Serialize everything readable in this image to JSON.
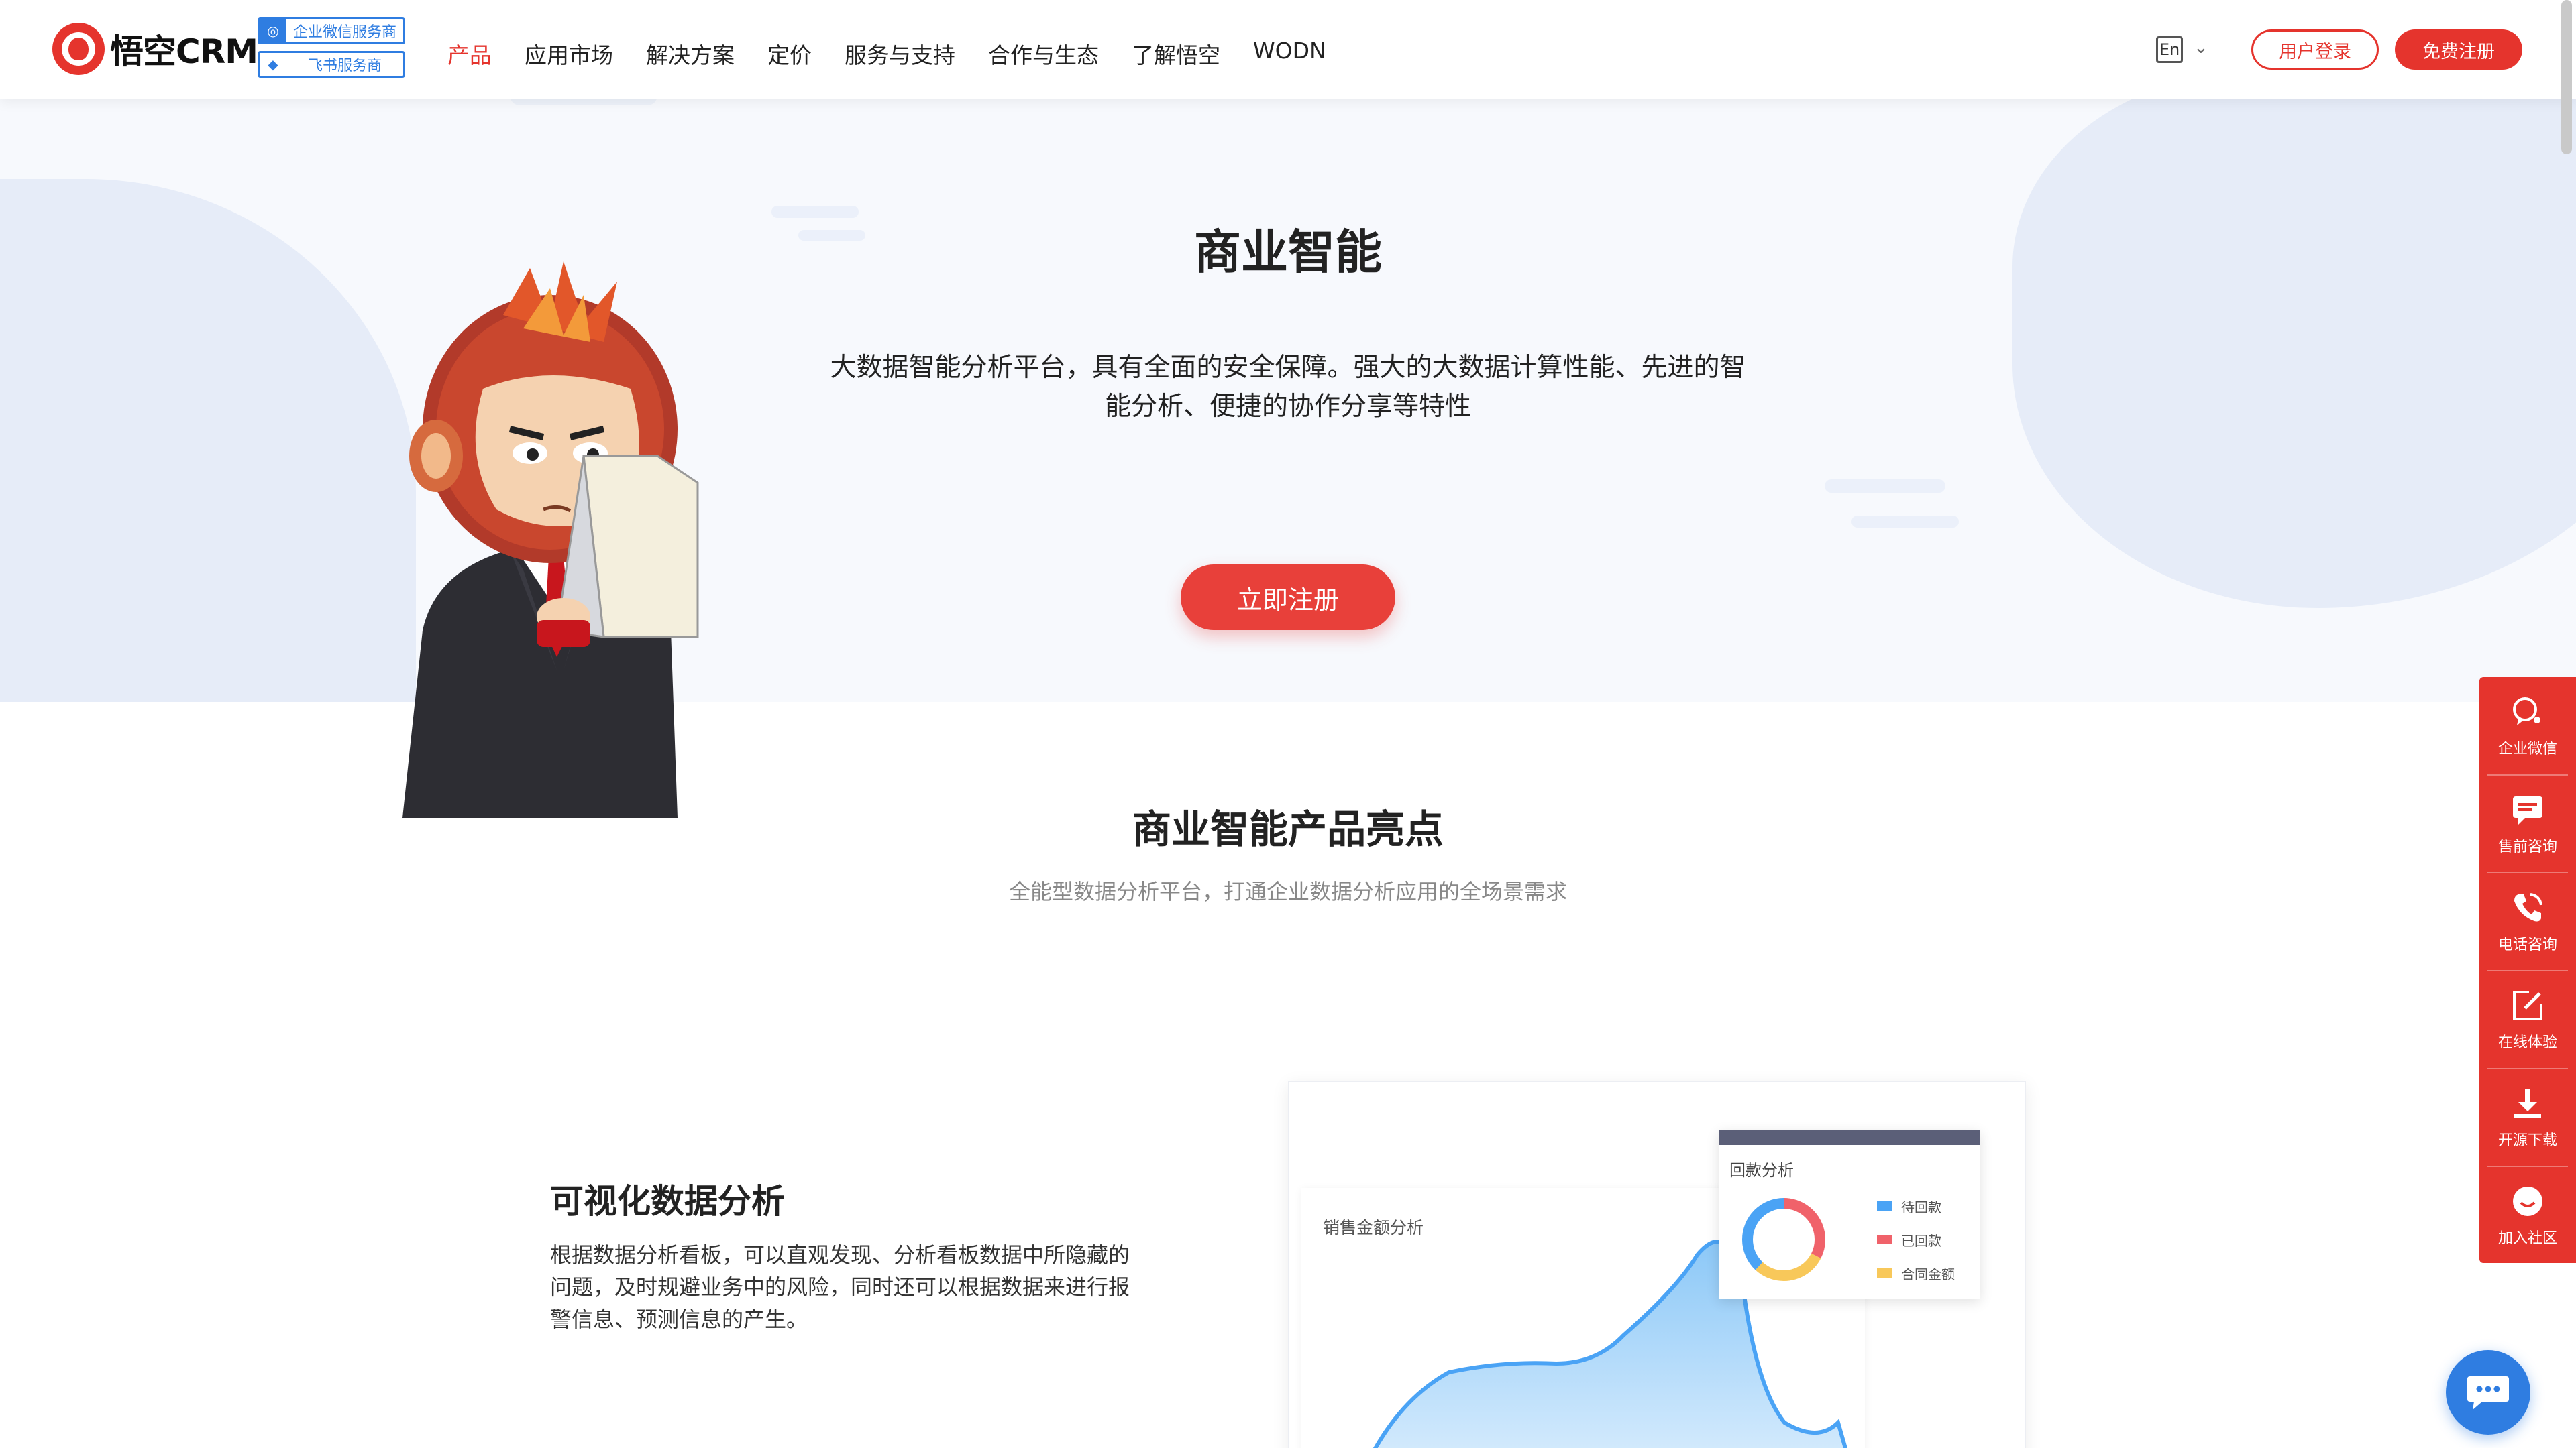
{
  "header": {
    "logo_text": "悟空CRM",
    "partners": [
      {
        "label": "企业微信服务商",
        "icon": "wecom-icon"
      },
      {
        "label": "飞书服务商",
        "icon": "feishu-icon"
      }
    ],
    "nav": [
      "产品",
      "应用市场",
      "解决方案",
      "定价",
      "服务与支持",
      "合作与生态",
      "了解悟空",
      "WODN"
    ],
    "lang": "En",
    "login": "用户登录",
    "register": "免费注册"
  },
  "hero": {
    "title": "商业智能",
    "desc": "大数据智能分析平台，具有全面的安全保障。强大的大数据计算性能、先进的智能分析、便捷的协作分享等特性",
    "cta": "立即注册"
  },
  "highlights": {
    "title": "商业智能产品亮点",
    "subtitle": "全能型数据分析平台，打通企业数据分析应用的全场景需求"
  },
  "feature": {
    "title": "可视化数据分析",
    "desc": "根据数据分析看板，可以直观发现、分析看板数据中所隐藏的问题，及时规避业务中的风险，同时还可以根据数据来进行报警信息、预测信息的产生。"
  },
  "preview": {
    "sales_title": "销售金额分析",
    "payback_title": "回款分析",
    "legend": [
      {
        "label": "待回款",
        "color": "#4aa3f5"
      },
      {
        "label": "已回款",
        "color": "#f0626a"
      },
      {
        "label": "合同金额",
        "color": "#f8c85a"
      }
    ]
  },
  "floatbar": [
    {
      "label": "企业微信",
      "icon": "wechat-icon"
    },
    {
      "label": "售前咨询",
      "icon": "message-icon"
    },
    {
      "label": "电话咨询",
      "icon": "phone-icon"
    },
    {
      "label": "在线体验",
      "icon": "edit-icon"
    },
    {
      "label": "开源下载",
      "icon": "download-icon"
    },
    {
      "label": "加入社区",
      "icon": "community-icon"
    }
  ],
  "colors": {
    "brand": "#e5342d",
    "accent_blue": "#2f7de1"
  }
}
